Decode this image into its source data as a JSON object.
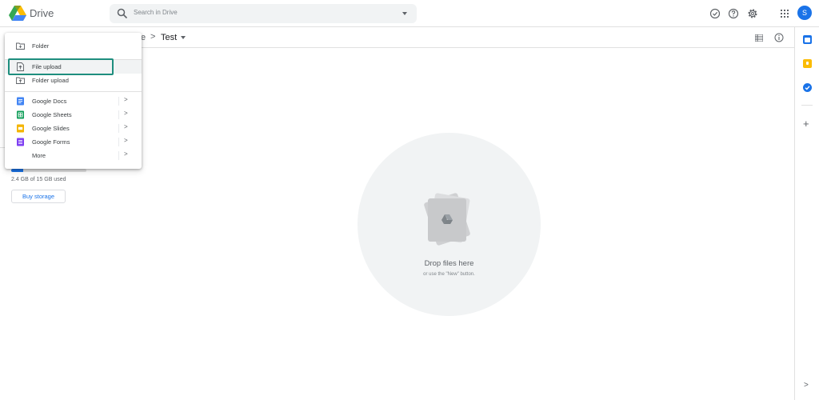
{
  "header": {
    "brand": "Drive",
    "search_placeholder": "Search in Drive",
    "avatar_letter": "S"
  },
  "breadcrumb": {
    "parent_partial": "e",
    "separator": ">",
    "current": "Test"
  },
  "new_menu": {
    "items": [
      {
        "label": "Folder",
        "icon": "new-folder-icon"
      },
      {
        "label": "File upload",
        "icon": "file-upload-icon"
      },
      {
        "label": "Folder upload",
        "icon": "folder-upload-icon"
      },
      {
        "label": "Google Docs",
        "icon": "google-docs-icon",
        "color": "#4285f4"
      },
      {
        "label": "Google Sheets",
        "icon": "google-sheets-icon",
        "color": "#0f9d58"
      },
      {
        "label": "Google Slides",
        "icon": "google-slides-icon",
        "color": "#f4b400"
      },
      {
        "label": "Google Forms",
        "icon": "google-forms-icon",
        "color": "#7e3ff2"
      },
      {
        "label": "More",
        "icon": ""
      }
    ],
    "submenu_arrow": ">"
  },
  "storage": {
    "used_text": "2.4 GB of 15 GB used",
    "used_fraction": 0.16,
    "buy_label": "Buy storage"
  },
  "drop_zone": {
    "title": "Drop files here",
    "subtitle": "or use the \"New\" button."
  },
  "side_panel": {
    "plus": "+",
    "collapse": ">"
  },
  "colors": {
    "accent": "#1a73e8",
    "focus_outline": "#1e8e7e",
    "search_bg": "#f1f3f4"
  }
}
